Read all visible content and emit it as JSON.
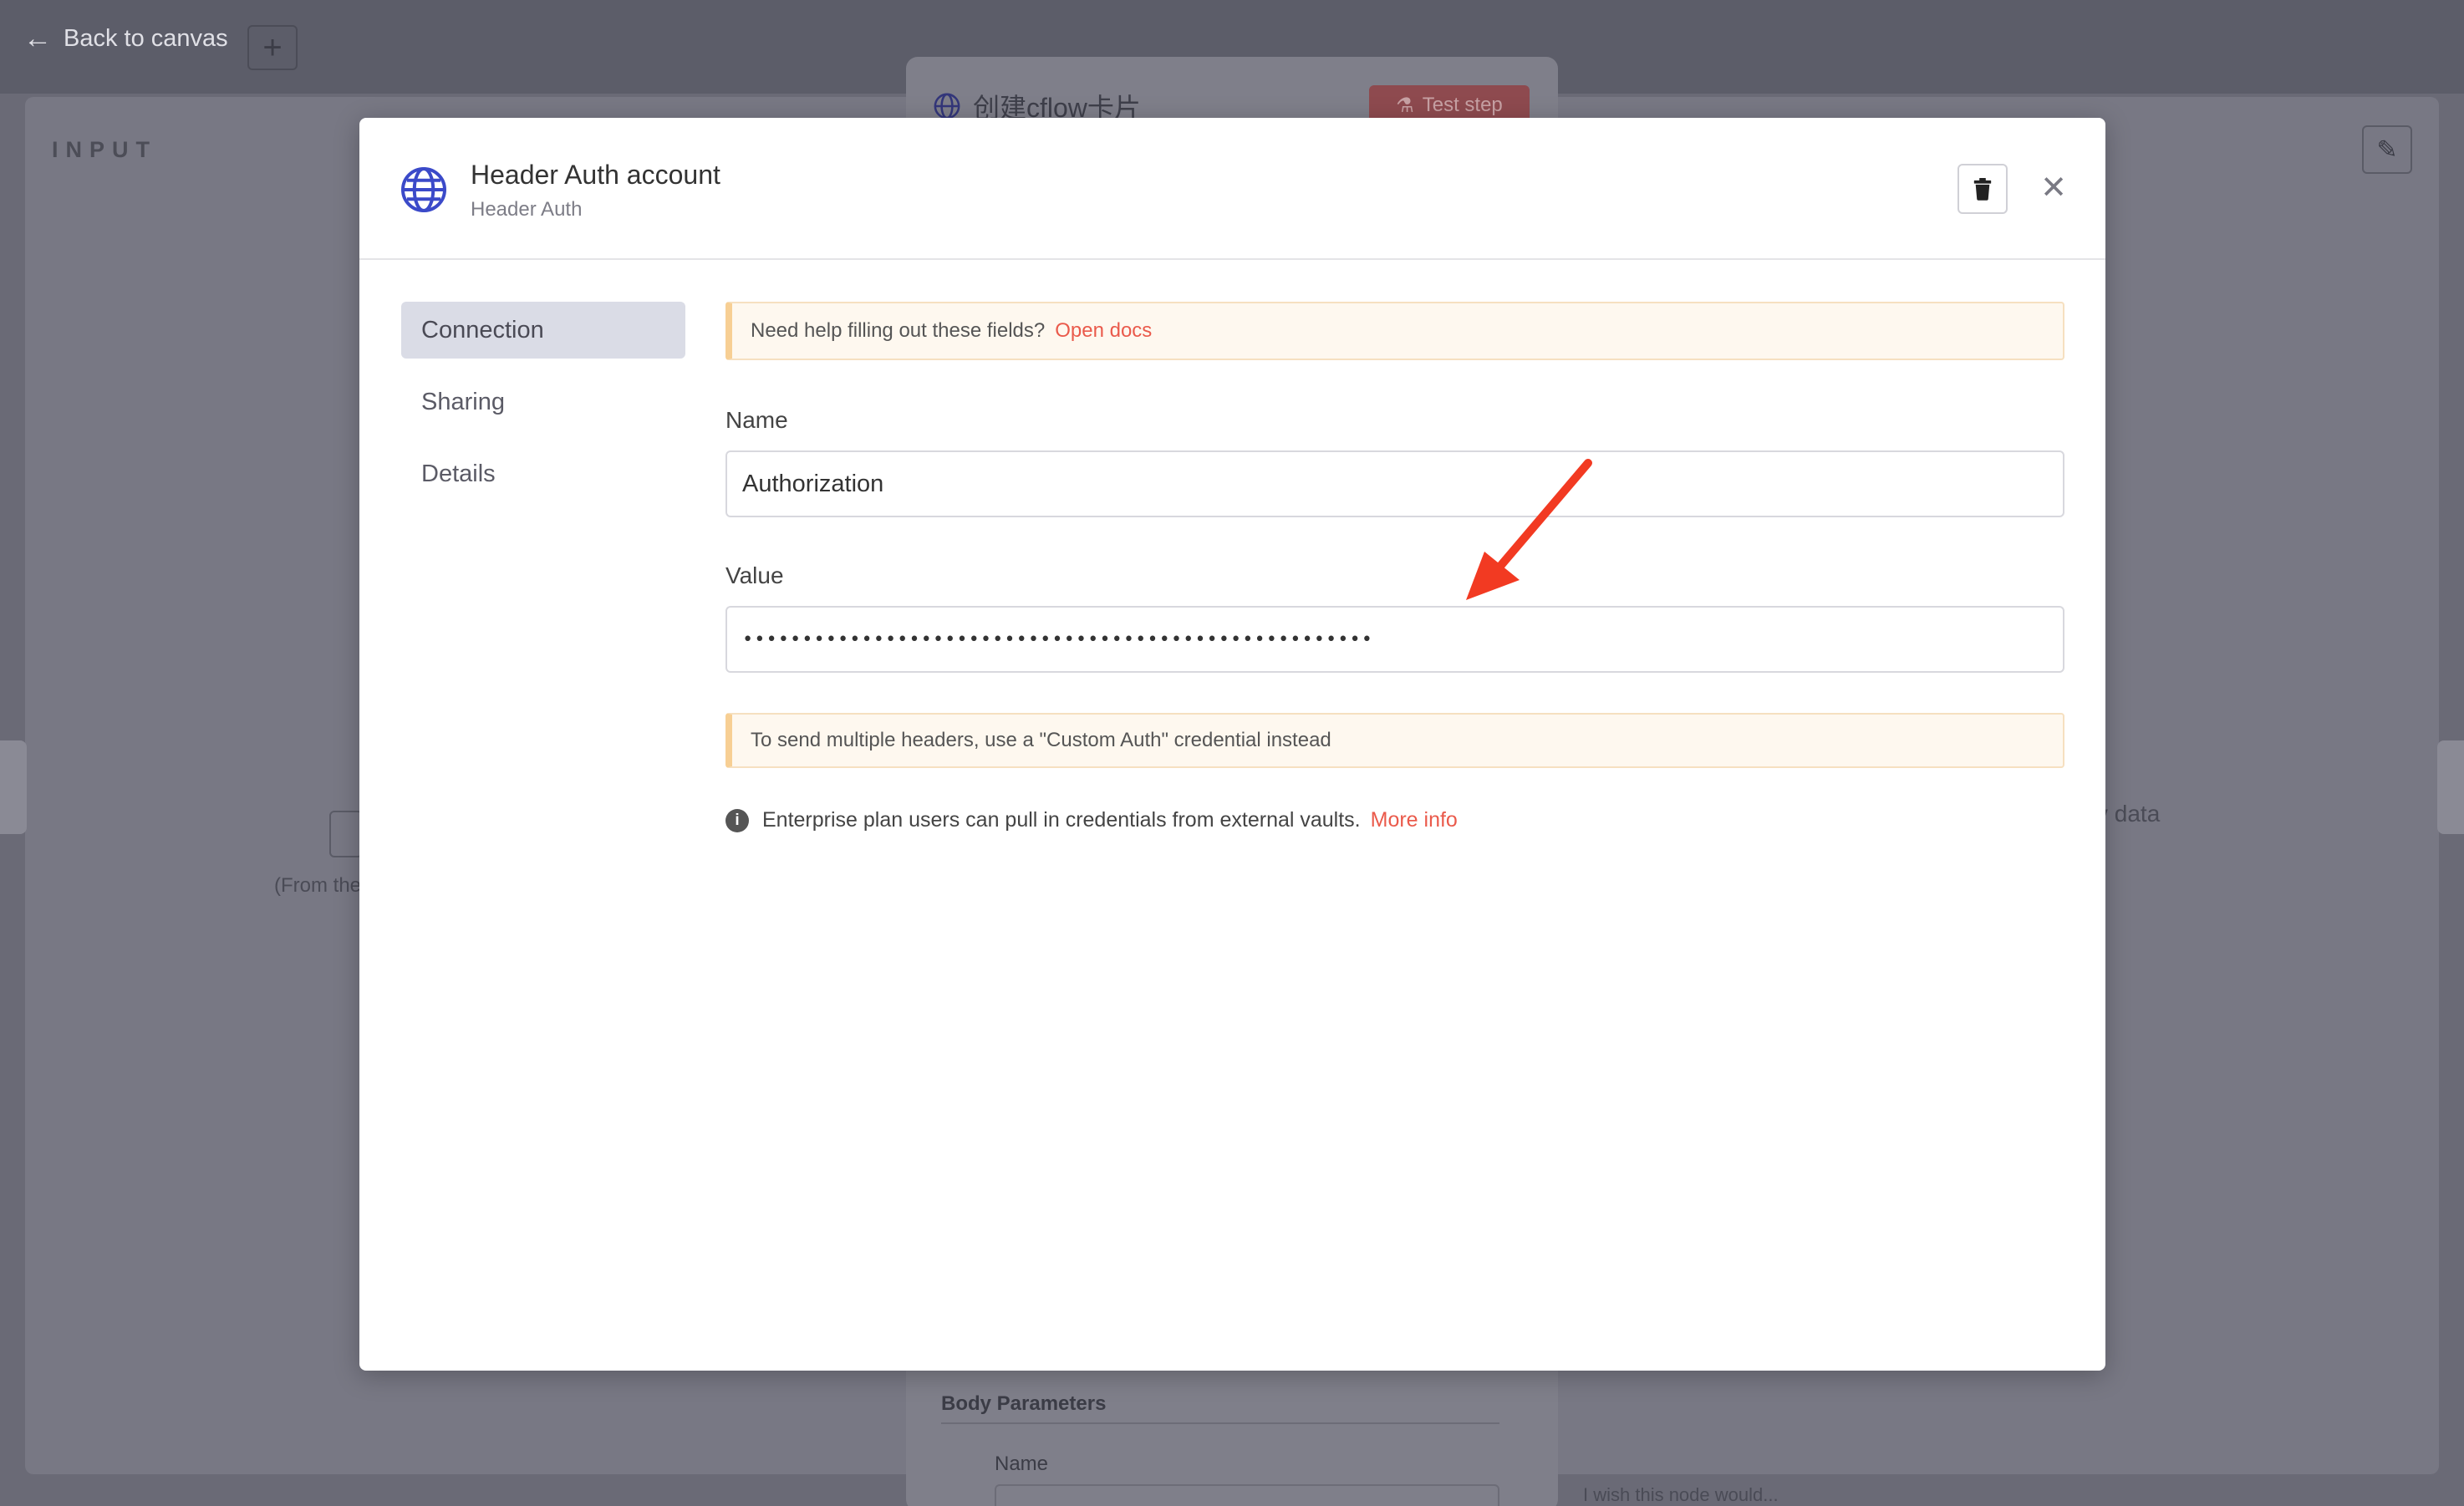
{
  "background": {
    "back_link": "Back to canvas",
    "plus": "+",
    "input_label": "INPUT",
    "node_title": "创建cflow卡片",
    "test_step": "Test step",
    "data_text": "v data",
    "from_text": "(From the",
    "body_parameters": "Body Parameters",
    "bg_name": "Name",
    "wish_text": "I wish this node would..."
  },
  "modal": {
    "title": "Header Auth account",
    "subtitle": "Header Auth",
    "nav": [
      {
        "label": "Connection",
        "active": true
      },
      {
        "label": "Sharing",
        "active": false
      },
      {
        "label": "Details",
        "active": false
      }
    ],
    "help_callout": {
      "text": "Need help filling out these fields?",
      "link": "Open docs"
    },
    "name_field": {
      "label": "Name",
      "value": "Authorization"
    },
    "value_field": {
      "label": "Value",
      "value": "•••••••••••••••••••••••••••••••••••••••••••••••••••••"
    },
    "multi_header_callout": "To send multiple headers, use a \"Custom Auth\" credential instead",
    "info": {
      "text": "Enterprise plan users can pull in credentials from external vaults.",
      "link": "More info"
    }
  },
  "icons": {
    "credential": "globe-icon",
    "delete": "trash-icon",
    "close": "close-icon",
    "info": "info-icon",
    "back": "arrow-left-icon",
    "edit": "pencil-icon"
  },
  "colors": {
    "accent_link": "#ea5a4b",
    "globe": "#3b4ac9",
    "callout_border": "#f7cf94",
    "callout_bg": "#fef8ef",
    "annotation_arrow": "#f23a22"
  }
}
